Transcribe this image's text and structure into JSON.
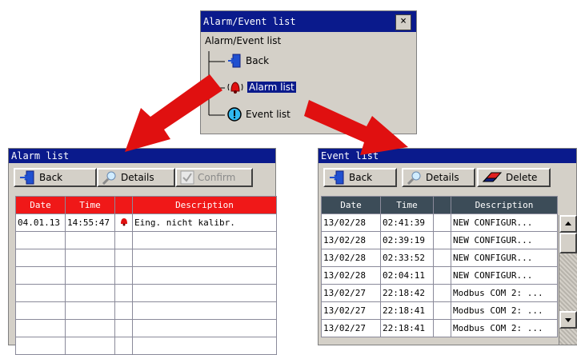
{
  "menu": {
    "title": "Alarm/Event list",
    "close": "×",
    "root": "Alarm/Event list",
    "items": [
      {
        "label": "Back",
        "icon": "back-door-icon"
      },
      {
        "label": "Alarm list",
        "icon": "alarm-bell-icon",
        "selected": true
      },
      {
        "label": "Event list",
        "icon": "info-exclamation-icon"
      }
    ]
  },
  "alarm": {
    "title": "Alarm list",
    "toolbar": {
      "back": "Back",
      "details": "Details",
      "confirm": "Confirm"
    },
    "columns": [
      "Date",
      "Time",
      "",
      "Description"
    ],
    "rows": [
      {
        "date": "04.01.13",
        "time": "14:55:47",
        "desc": "Eing. nicht kalibr."
      }
    ]
  },
  "event": {
    "title": "Event list",
    "toolbar": {
      "back": "Back",
      "details": "Details",
      "delete": "Delete"
    },
    "columns": [
      "Date",
      "Time",
      "",
      "Description"
    ],
    "rows": [
      {
        "date": "13/02/28",
        "time": "02:41:39",
        "desc": "NEW CONFIGUR..."
      },
      {
        "date": "13/02/28",
        "time": "02:39:19",
        "desc": "NEW CONFIGUR..."
      },
      {
        "date": "13/02/28",
        "time": "02:33:52",
        "desc": "NEW CONFIGUR..."
      },
      {
        "date": "13/02/28",
        "time": "02:04:11",
        "desc": "NEW CONFIGUR..."
      },
      {
        "date": "13/02/27",
        "time": "22:18:42",
        "desc": "Modbus COM 2: ..."
      },
      {
        "date": "13/02/27",
        "time": "22:18:41",
        "desc": "Modbus COM 2: ..."
      },
      {
        "date": "13/02/27",
        "time": "22:18:41",
        "desc": "Modbus COM 2: ..."
      }
    ]
  },
  "colors": {
    "titlebar": "#0a1a8c",
    "alarm_header": "#f01818",
    "event_header": "#3c4c58",
    "arrow": "#e01010"
  }
}
